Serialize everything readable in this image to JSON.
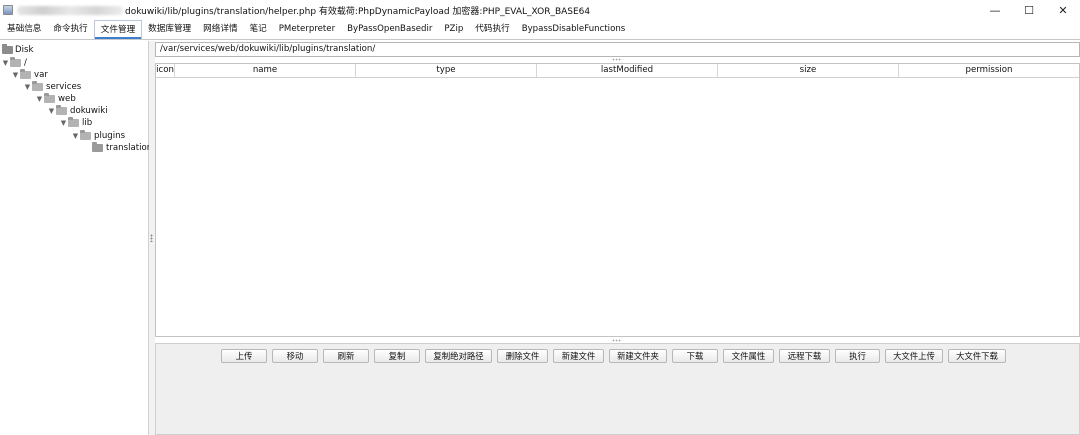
{
  "window": {
    "title": "dokuwiki/lib/plugins/translation/helper.php 有效载荷:PhpDynamicPayload 加密器:PHP_EVAL_XOR_BASE64",
    "minimize_glyph": "—",
    "maximize_glyph": "☐",
    "close_glyph": "✕"
  },
  "tabs": [
    {
      "label": "基础信息"
    },
    {
      "label": "命令执行"
    },
    {
      "label": "文件管理",
      "active": true
    },
    {
      "label": "数据库管理"
    },
    {
      "label": "网络详情"
    },
    {
      "label": "笔记"
    },
    {
      "label": "PMeterpreter"
    },
    {
      "label": "ByPassOpenBasedir"
    },
    {
      "label": "PZip"
    },
    {
      "label": "代码执行"
    },
    {
      "label": "BypassDisableFunctions"
    }
  ],
  "tree": {
    "root": "Disk",
    "nodes": [
      {
        "label": "/",
        "expanded": true
      },
      {
        "label": "var",
        "expanded": true
      },
      {
        "label": "services",
        "expanded": true
      },
      {
        "label": "web",
        "expanded": true
      },
      {
        "label": "dokuwiki",
        "expanded": true
      },
      {
        "label": "lib",
        "expanded": true
      },
      {
        "label": "plugins",
        "expanded": true
      },
      {
        "label": "translation",
        "expanded": false
      }
    ]
  },
  "path": "/var/services/web/dokuwiki/lib/plugins/translation/",
  "table": {
    "columns": [
      "icon",
      "name",
      "type",
      "lastModified",
      "size",
      "permission"
    ]
  },
  "buttons": [
    {
      "label": "上传"
    },
    {
      "label": "移动"
    },
    {
      "label": "刷新"
    },
    {
      "label": "复制"
    },
    {
      "label": "复制绝对路径"
    },
    {
      "label": "删除文件"
    },
    {
      "label": "新建文件"
    },
    {
      "label": "新建文件夹"
    },
    {
      "label": "下载"
    },
    {
      "label": "文件属性"
    },
    {
      "label": "远程下载"
    },
    {
      "label": "执行"
    },
    {
      "label": "大文件上传"
    },
    {
      "label": "大文件下载"
    }
  ],
  "colors": {
    "active_tab_accent": "#3c7fd1",
    "panel_bg": "#efefef",
    "border": "#c3c3c3"
  }
}
